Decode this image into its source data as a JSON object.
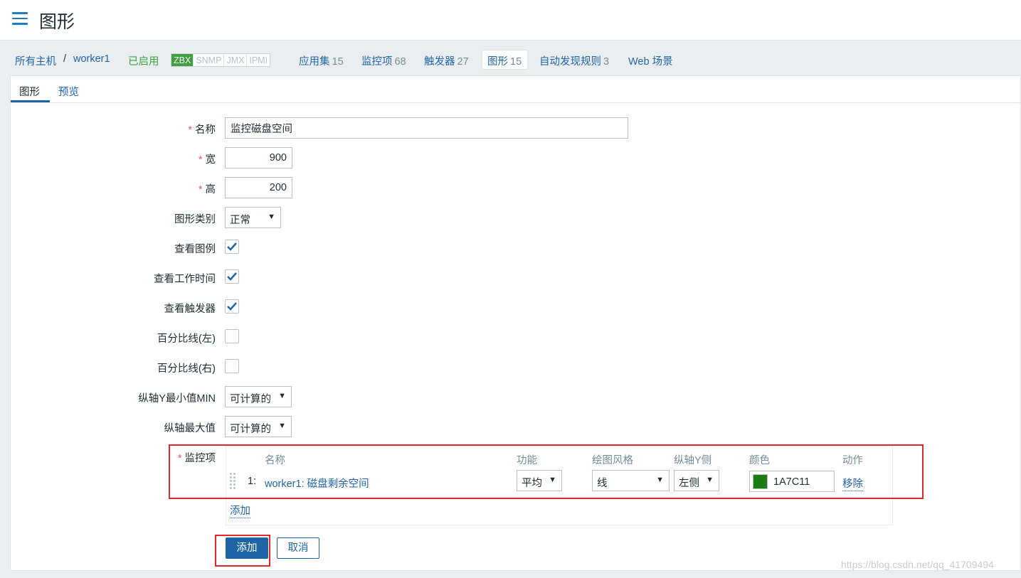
{
  "header": {
    "title": "图形",
    "menu_icon": "hamburger-menu-icon"
  },
  "breadcrumb": {
    "all_hosts": "所有主机",
    "separator": "/",
    "host": "worker1",
    "status": "已启用",
    "protocols": [
      "ZBX",
      "SNMP",
      "JMX",
      "IPMI"
    ],
    "nav": [
      {
        "label": "应用集",
        "count": "15"
      },
      {
        "label": "监控项",
        "count": "68"
      },
      {
        "label": "触发器",
        "count": "27"
      },
      {
        "label": "图形",
        "count": "15"
      },
      {
        "label": "自动发现规则",
        "count": "3"
      },
      {
        "label": "Web 场景",
        "count": ""
      }
    ]
  },
  "tabs": [
    "图形",
    "预览"
  ],
  "form": {
    "required_mark": "*",
    "name": {
      "label": "名称",
      "value": "监控磁盘空间"
    },
    "width": {
      "label": "宽",
      "value": "900"
    },
    "height": {
      "label": "高",
      "value": "200"
    },
    "graph_type": {
      "label": "图形类别",
      "value": "正常"
    },
    "show_legend": {
      "label": "查看图例",
      "checked": true
    },
    "show_working_time": {
      "label": "查看工作时间",
      "checked": true
    },
    "show_triggers": {
      "label": "查看触发器",
      "checked": true
    },
    "percentile_left": {
      "label": "百分比线(左)",
      "checked": false
    },
    "percentile_right": {
      "label": "百分比线(右)",
      "checked": false
    },
    "y_min": {
      "label": "纵轴Y最小值MIN",
      "value": "可计算的"
    },
    "y_max": {
      "label": "纵轴最大值",
      "value": "可计算的"
    },
    "items": {
      "label": "监控项",
      "columns": [
        "名称",
        "功能",
        "绘图风格",
        "纵轴Y侧",
        "颜色",
        "动作"
      ],
      "rows": [
        {
          "num": "1:",
          "name": "worker1: 磁盘剩余空间",
          "function": "平均",
          "style": "线",
          "y_side": "左侧",
          "color": "1A7C11",
          "color_hex": "#1A7C11",
          "action": "移除"
        }
      ],
      "add_link": "添加"
    }
  },
  "buttons": {
    "add": "添加",
    "cancel": "取消"
  },
  "watermark": "https://blog.csdn.net/qq_41709494"
}
